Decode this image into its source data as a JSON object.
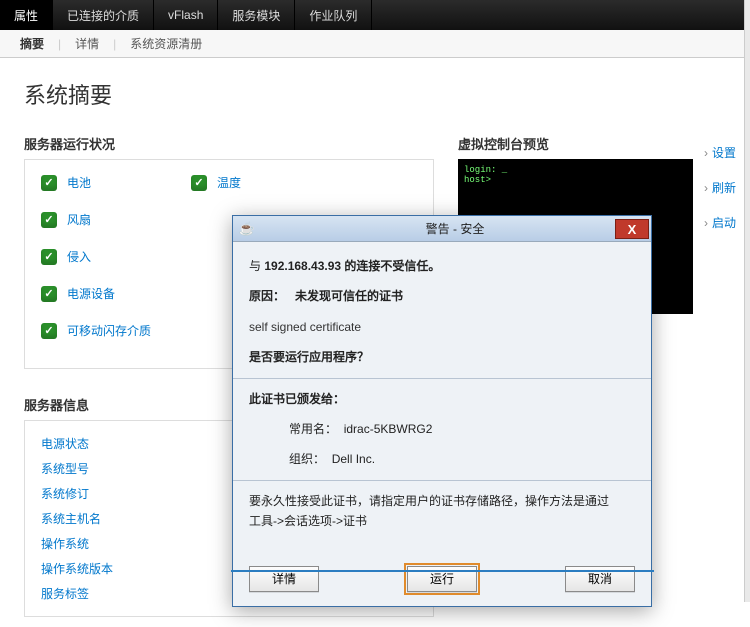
{
  "topnav": {
    "tabs": [
      "属性",
      "已连接的介质",
      "vFlash",
      "服务模块",
      "作业队列"
    ],
    "active": 0
  },
  "subnav": {
    "items": [
      "摘要",
      "详情",
      "系统资源清册"
    ],
    "active": 0
  },
  "page_title": "系统摘要",
  "health": {
    "title": "服务器运行状况",
    "items_col1": [
      "电池",
      "风扇",
      "侵入",
      "电源设备",
      "可移动闪存介质"
    ],
    "items_col2": [
      "温度"
    ]
  },
  "info": {
    "title": "服务器信息",
    "items": [
      "电源状态",
      "系统型号",
      "系统修订",
      "系统主机名",
      "操作系统",
      "操作系统版本",
      "服务标签"
    ]
  },
  "preview": {
    "title": "虚拟控制台预览",
    "console_lines": [
      "login: _",
      "",
      "",
      "host> "
    ]
  },
  "rightlinks": [
    "设置",
    "刷新",
    "启动"
  ],
  "dialog": {
    "title": "警告 - 安全",
    "line1_prefix": "与 ",
    "ip": "192.168.43.93",
    "line1_suffix": " 的连接不受信任。",
    "reason_label": "原因：",
    "reason_value": "未发现可信任的证书",
    "self_signed": "self signed certificate",
    "question": "是否要运行应用程序？",
    "issued_to": "此证书已颁发给：",
    "cn_label": "常用名：",
    "cn_value": "idrac-5KBWRG2",
    "org_label": "组织：",
    "org_value": "Dell Inc.",
    "perm_text1": "要永久性接受此证书，请指定用户的证书存储路径，操作方法是通过",
    "perm_text2": "工具->会话选项->证书",
    "btn_details": "详情",
    "btn_run": "运行",
    "btn_cancel": "取消"
  }
}
